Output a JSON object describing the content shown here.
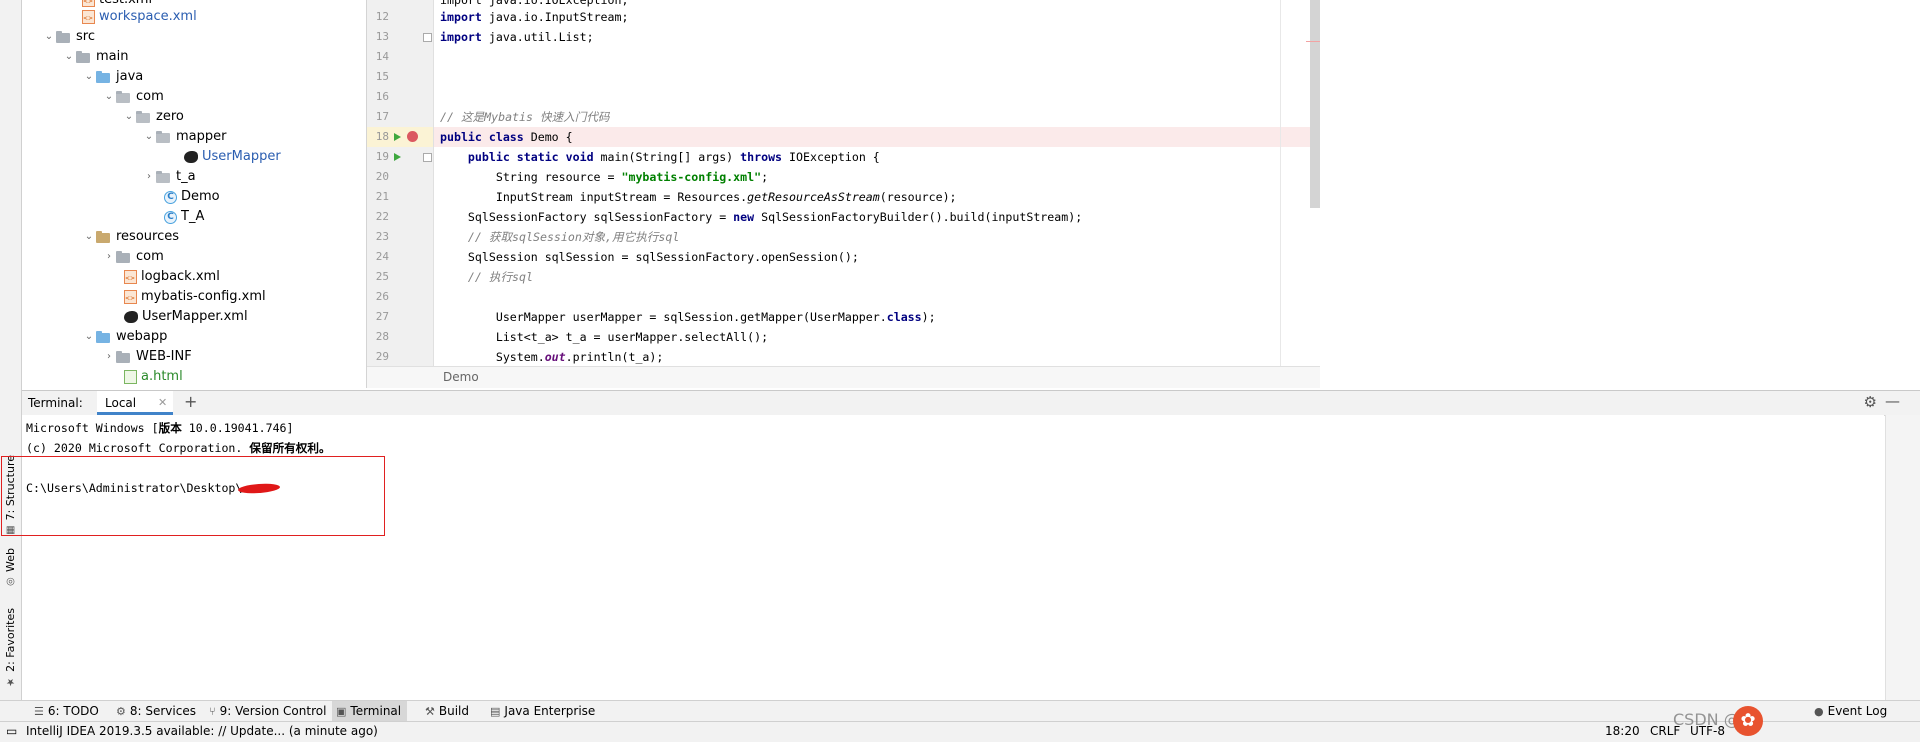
{
  "left_strip": {
    "structure_label": "7: Structure",
    "web_label": "Web",
    "favorites_label": "2: Favorites"
  },
  "project_tree": [
    {
      "label": "test.xml",
      "icon": "xml-file-icon",
      "color": "#000000"
    },
    {
      "label": "workspace.xml",
      "icon": "xml-file-icon",
      "color": "#2a5db0"
    },
    {
      "label": "src",
      "icon": "folder-icon",
      "color": "#000000"
    },
    {
      "label": "main",
      "icon": "folder-icon",
      "color": "#000000"
    },
    {
      "label": "java",
      "icon": "source-folder-icon",
      "color": "#000000"
    },
    {
      "label": "com",
      "icon": "package-icon",
      "color": "#000000"
    },
    {
      "label": "zero",
      "icon": "package-icon",
      "color": "#000000"
    },
    {
      "label": "mapper",
      "icon": "package-icon",
      "color": "#000000"
    },
    {
      "label": "UserMapper",
      "icon": "mybatis-bird-icon",
      "color": "#2a5db0"
    },
    {
      "label": "t_a",
      "icon": "package-icon",
      "color": "#000000"
    },
    {
      "label": "Demo",
      "icon": "class-icon",
      "color": "#000000"
    },
    {
      "label": "T_A",
      "icon": "class-icon",
      "color": "#000000"
    },
    {
      "label": "resources",
      "icon": "resources-folder-icon",
      "color": "#000000"
    },
    {
      "label": "com",
      "icon": "folder-icon",
      "color": "#000000"
    },
    {
      "label": "logback.xml",
      "icon": "xml-file-icon",
      "color": "#000000"
    },
    {
      "label": "mybatis-config.xml",
      "icon": "xml-file-icon",
      "color": "#000000"
    },
    {
      "label": "UserMapper.xml",
      "icon": "mybatis-bird-icon",
      "color": "#000000"
    },
    {
      "label": "webapp",
      "icon": "web-folder-icon",
      "color": "#000000"
    },
    {
      "label": "WEB-INF",
      "icon": "folder-icon",
      "color": "#000000"
    },
    {
      "label": "a.html",
      "icon": "html-file-icon",
      "color": "#2a8a2a"
    }
  ],
  "editor": {
    "line_numbers": [
      "12",
      "13",
      "14",
      "15",
      "16",
      "17",
      "18",
      "19",
      "20",
      "21",
      "22",
      "23",
      "24",
      "25",
      "26",
      "27",
      "28",
      "29"
    ],
    "breadcrumb": "Demo",
    "code": {
      "l11": "import java.io.IOException;",
      "l12a": "import",
      "l12b": " java.io.InputStream;",
      "l13a": "import",
      "l13b": " java.util.List;",
      "l17": "// 这是Mybatis 快速入门代码",
      "l18a": "public class",
      "l18b": " Demo {",
      "l19a": "    public static void",
      "l19b": " main(String[] args) ",
      "l19c": "throws",
      "l19d": " IOException {",
      "l20a": "        String resource = ",
      "l20b": "\"mybatis-config.xml\"",
      "l20c": ";",
      "l21a": "        InputStream inputStream = Resources.",
      "l21b": "getResourceAsStream",
      "l21c": "(resource);",
      "l22a": "    SqlSessionFactory sqlSessionFactory = ",
      "l22b": "new",
      "l22c": " SqlSessionFactoryBuilder().build(inputStream);",
      "l23": "    // 获取sqlSession对象,用它执行sql",
      "l24": "    SqlSession sqlSession = sqlSessionFactory.openSession();",
      "l25": "    // 执行sql",
      "l27a": "        UserMapper userMapper = sqlSession.getMapper(UserMapper.",
      "l27b": "class",
      "l27c": ");",
      "l28": "        List<t_a> t_a = userMapper.selectAll();",
      "l29a": "        System.",
      "l29b": "out",
      "l29c": ".println(t_a);"
    }
  },
  "terminal": {
    "title": "Terminal:",
    "tab_label": "Local",
    "lines": {
      "l1a": "Microsoft Windows [",
      "l1b": "版本",
      "l1c": " 10.0.19041.746]",
      "l2a": "(c) 2020 Microsoft Corporation. ",
      "l2b": "保留所有权利。",
      "l3": "C:\\Users\\Administrator\\Desktop\\"
    }
  },
  "bottom_tabs": [
    {
      "label": "6: TODO",
      "icon": "todo-icon"
    },
    {
      "label": "8: Services",
      "icon": "services-icon"
    },
    {
      "label": "9: Version Control",
      "icon": "version-control-icon"
    },
    {
      "label": "Terminal",
      "icon": "terminal-icon"
    },
    {
      "label": "Build",
      "icon": "build-icon"
    },
    {
      "label": "Java Enterprise",
      "icon": "java-enterprise-icon"
    }
  ],
  "status_bar": {
    "message": "IntelliJ IDEA 2019.3.5 available: // Update... (a minute ago)",
    "position": "18:20",
    "line_separator": "CRLF",
    "encoding": "UTF-8",
    "event_log": "Event Log",
    "watermark": "CSDN @"
  },
  "colors": {
    "keyword": "#000080",
    "string": "#008000",
    "comment": "#808080",
    "breakpoint": "#db5860",
    "annotation_box": "#e02020"
  }
}
